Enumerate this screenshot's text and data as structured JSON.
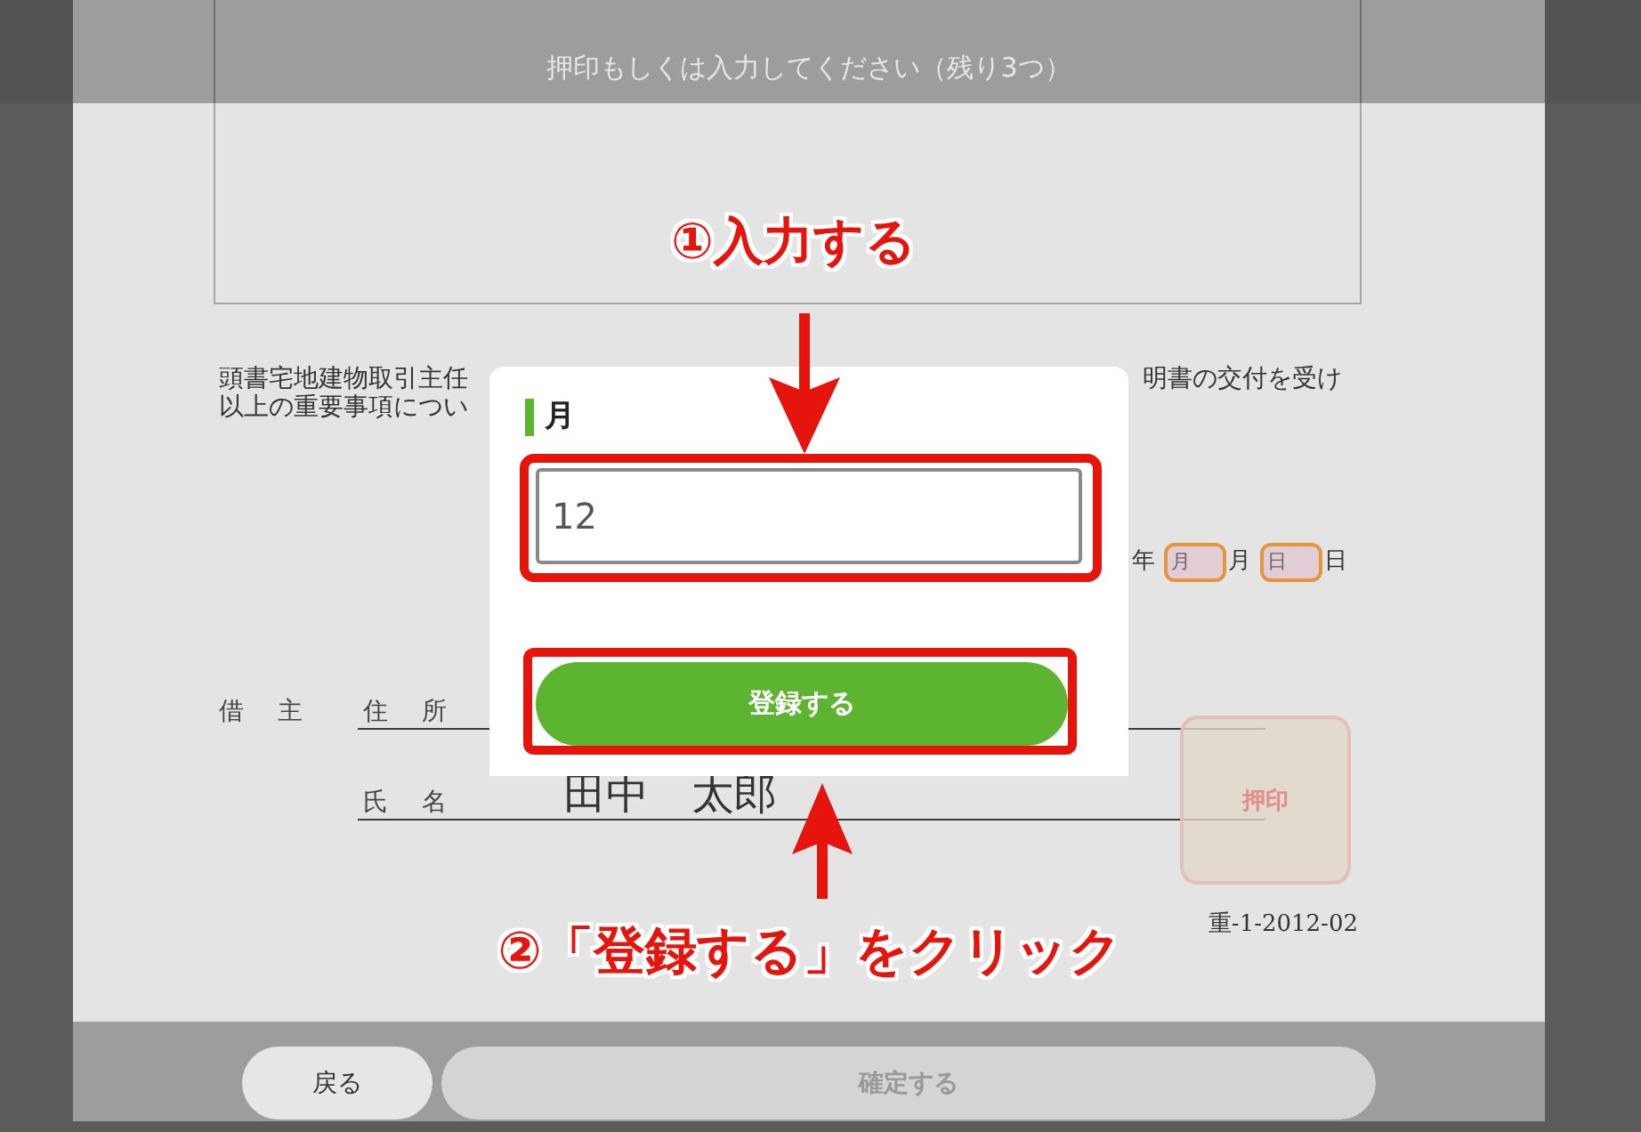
{
  "header": {
    "instruction": "押印もしくは入力してください（残り3つ）"
  },
  "document": {
    "paragraph_lines": [
      {
        "left": "頭書宅地建物取引主任",
        "right": "明書の交付を受け"
      },
      {
        "left": "以上の重要事項につい"
      }
    ],
    "date_row": [
      {
        "kind": "label",
        "text": "年"
      },
      {
        "kind": "field",
        "placeholder": "月"
      },
      {
        "kind": "label",
        "text": "月"
      },
      {
        "kind": "field",
        "placeholder": "日"
      },
      {
        "kind": "label",
        "text": "日"
      }
    ],
    "borrower": {
      "label": "借　主",
      "rows": [
        {
          "label": "住　所"
        },
        {
          "label": "氏　名",
          "value": "田中　太郎"
        }
      ]
    },
    "stamp": {
      "label": "押印"
    },
    "doc_code": "重-1-2012-02"
  },
  "modal": {
    "title": "月",
    "input": {
      "value": "12",
      "highlighted": true
    },
    "submit_button": {
      "label": "登録する",
      "highlighted": true
    }
  },
  "callouts": [
    {
      "kind": "down",
      "text": "①入力する"
    },
    {
      "kind": "up",
      "text": "②「登録する」をクリック"
    }
  ],
  "footer": {
    "buttons": [
      {
        "label": "戻る",
        "disabled": false
      },
      {
        "label": "確定する",
        "disabled": true
      }
    ]
  }
}
